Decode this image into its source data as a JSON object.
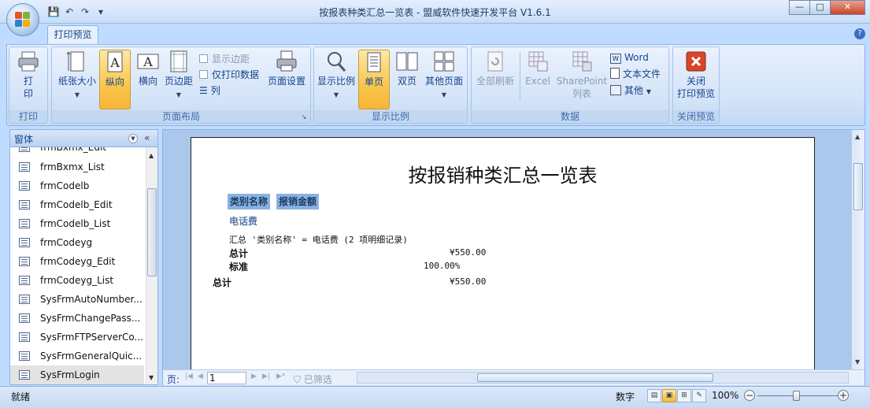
{
  "window": {
    "title": "按报表种类汇总一览表 - 盟威软件快速开发平台 V1.6.1",
    "buttons": {
      "minimize": "—",
      "maximize": "□",
      "close": "✕"
    }
  },
  "quick_access": {
    "icons": [
      "save-icon",
      "undo-icon",
      "redo-icon",
      "customize-icon"
    ]
  },
  "ribbon": {
    "tab": "打印预览",
    "help": "?",
    "groups": {
      "print": {
        "title": "打印",
        "print_label": "打\n印"
      },
      "page_layout": {
        "title": "页面布局",
        "paper_size": "纸张大小",
        "portrait": "纵向",
        "landscape": "横向",
        "margins": "页边距",
        "show_margins": "显示边距",
        "print_data_only": "仅打印数据",
        "columns": "列",
        "page_setup": "页面设置"
      },
      "zoom": {
        "title": "显示比例",
        "zoom": "显示比例",
        "one_page": "单页",
        "two_pages": "双页",
        "more_pages": "其他页面"
      },
      "data": {
        "title": "数据",
        "refresh_all": "全部刷新",
        "excel": "Excel",
        "sharepoint_1": "SharePoint",
        "sharepoint_2": "列表",
        "word": "Word",
        "text_file": "文本文件",
        "more": "其他"
      },
      "close": {
        "title": "关闭预览",
        "close_1": "关闭",
        "close_2": "打印预览"
      }
    }
  },
  "nav_pane": {
    "header": "窗体",
    "items": [
      "frmBxmx_Edit",
      "frmBxmx_List",
      "frmCodelb",
      "frmCodelb_Edit",
      "frmCodelb_List",
      "frmCodeyg",
      "frmCodeyg_Edit",
      "frmCodeyg_List",
      "SysFrmAutoNumber...",
      "SysFrmChangePass...",
      "SysFrmFTPServerCo...",
      "SysFrmGeneralQuic...",
      "SysFrmLogin"
    ]
  },
  "report": {
    "title": "按报销种类汇总一览表",
    "col1": "类别名称",
    "col2": "报销金额",
    "group": "电话费",
    "summary_line": "汇总 '类别名称' = 电话费 (2 项明细记录)",
    "subtotal_label": "总计",
    "subtotal_value": "¥550.00",
    "standard_label": "标准",
    "standard_value": "100.00%",
    "grand_total_label": "总计",
    "grand_total_value": "¥550.00"
  },
  "navbar": {
    "page_label": "页:",
    "page_value": "1",
    "filter": "已筛选"
  },
  "status": {
    "text": "就绪",
    "mode": "数字",
    "zoom": "100%"
  }
}
